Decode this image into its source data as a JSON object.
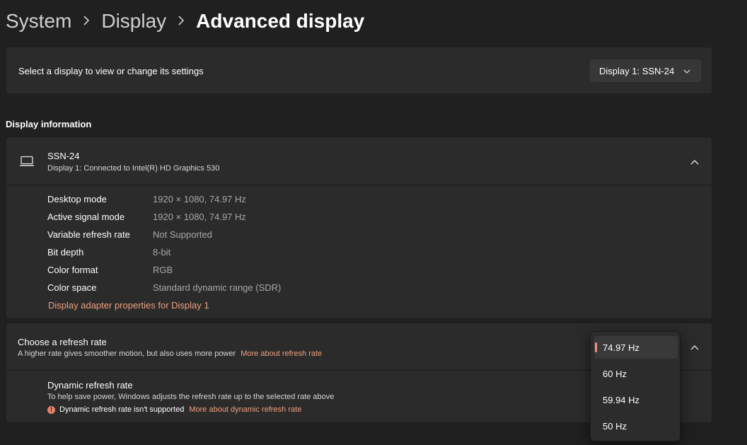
{
  "breadcrumb": {
    "items": [
      "System",
      "Display"
    ],
    "current": "Advanced display"
  },
  "select_display": {
    "label": "Select a display to view or change its settings",
    "selected": "Display 1: SSN-24"
  },
  "display_info": {
    "section_title": "Display information",
    "name": "SSN-24",
    "subtitle": "Display 1: Connected to Intel(R) HD Graphics 530",
    "rows": [
      {
        "key": "Desktop mode",
        "value": "1920 × 1080, 74.97 Hz"
      },
      {
        "key": "Active signal mode",
        "value": "1920 × 1080, 74.97 Hz"
      },
      {
        "key": "Variable refresh rate",
        "value": "Not Supported"
      },
      {
        "key": "Bit depth",
        "value": "8-bit"
      },
      {
        "key": "Color format",
        "value": "RGB"
      },
      {
        "key": "Color space",
        "value": "Standard dynamic range (SDR)"
      }
    ],
    "adapter_link": "Display adapter properties for Display 1"
  },
  "refresh_rate": {
    "title": "Choose a refresh rate",
    "subtitle": "A higher rate gives smoother motion, but also uses more power",
    "more_link": "More about refresh rate",
    "options": [
      "74.97 Hz",
      "60 Hz",
      "59.94 Hz",
      "50 Hz"
    ],
    "selected_index": 0
  },
  "dynamic_refresh": {
    "title": "Dynamic refresh rate",
    "subtitle": "To help save power, Windows adjusts the refresh rate up to the selected rate above",
    "warning": "Dynamic refresh rate isn't supported",
    "warning_icon": "!",
    "more_link": "More about dynamic refresh rate"
  },
  "colors": {
    "background": "#202020",
    "card": "#2b2b2b",
    "accent": "#f0a07e"
  },
  "icons": {
    "breadcrumb_separator": "chevron-right-icon",
    "dropdown": "chevron-down-icon",
    "expand": "chevron-up-icon",
    "monitor": "laptop-icon",
    "warning": "error-circle-icon"
  }
}
